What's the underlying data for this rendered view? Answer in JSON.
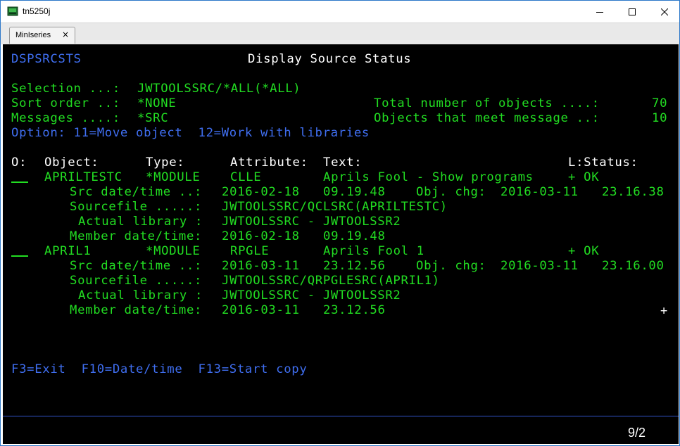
{
  "window": {
    "title": "tn5250j"
  },
  "tab": {
    "label": "MinIseries",
    "close_glyph": "×"
  },
  "screen": {
    "program_name": "DSPSRCSTS",
    "screen_title": "Display Source Status",
    "selection_label": "Selection ...:",
    "selection_value": "JWTOOLSSRC/*ALL(*ALL)",
    "sort_label": "Sort order ..:",
    "sort_value": "*NONE",
    "messages_label": "Messages ....:",
    "messages_value": "*SRC",
    "total_label": "Total number of objects ....:",
    "total_value": "70",
    "meet_label": "Objects that meet message ..:",
    "meet_value": "10",
    "options_line": "Option: 11=Move object  12=Work with libraries",
    "column_headers": {
      "opt": "O:",
      "object": "Object:",
      "type": "Type:",
      "attribute": "Attribute:",
      "text": "Text:",
      "status": "L:Status:"
    },
    "records": [
      {
        "object": "APRILTESTC",
        "type": "*MODULE",
        "attribute": "CLLE",
        "text": "Aprils Fool - Show programs",
        "status": "+ OK",
        "src_label": "Src date/time ..:",
        "src_date": "2016-02-18",
        "src_time": "09.19.48",
        "obj_chg_label": "Obj. chg:",
        "obj_chg_date": "2016-03-11",
        "obj_chg_time": "23.16.38",
        "sourcefile_label": "Sourcefile .....:",
        "sourcefile": "JWTOOLSSRC/QCLSRC(APRILTESTC)",
        "actual_label": "Actual library :",
        "actual_library": "JWTOOLSSRC - JWTOOLSSR2",
        "member_label": "Member date/time:",
        "member_date": "2016-02-18",
        "member_time": "09.19.48"
      },
      {
        "object": "APRIL1",
        "type": "*MODULE",
        "attribute": "RPGLE",
        "text": "Aprils Fool 1",
        "status": "+ OK",
        "src_label": "Src date/time ..:",
        "src_date": "2016-03-11",
        "src_time": "23.12.56",
        "obj_chg_label": "Obj. chg:",
        "obj_chg_date": "2016-03-11",
        "obj_chg_time": "23.16.00",
        "sourcefile_label": "Sourcefile .....:",
        "sourcefile": "JWTOOLSSRC/QRPGLESRC(APRIL1)",
        "actual_label": "Actual library :",
        "actual_library": "JWTOOLSSRC - JWTOOLSSR2",
        "member_label": "Member date/time:",
        "member_date": "2016-03-11",
        "member_time": "23.12.56"
      }
    ],
    "more_indicator": "+",
    "function_keys": "F3=Exit  F10=Date/time  F13=Start copy"
  },
  "status_bar": {
    "cursor_position": "9/2"
  },
  "colors": {
    "terminal_bg": "#000000",
    "field_green": "#22dd22",
    "label_blue": "#3f6ef0",
    "highlight_white": "#ffffff"
  }
}
